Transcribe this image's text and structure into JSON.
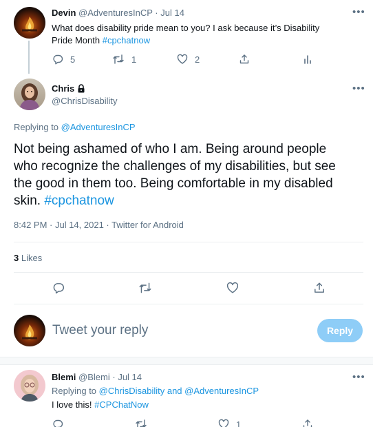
{
  "tweet1": {
    "name": "Devin",
    "handle": "@AdventuresInCP",
    "time": "Jul 14",
    "text_line1": "What does disability pride mean to you? I ask because it’s Disability",
    "text_line2": "Pride Month",
    "hashtag": "#cpchatnow",
    "replies": "5",
    "retweets": "1",
    "likes": "2"
  },
  "main_tweet": {
    "name": "Chris",
    "handle": "@ChrisDisability",
    "replying_prefix": "Replying to",
    "replying_handle": "@AdventuresInCP",
    "text_line1": "Not being ashamed of who I am. Being around people",
    "text_line2": "who recognize the challenges of my disabilities, but see",
    "text_line3": "the good in them too. Being comfortable in my disabled",
    "text_line4": "skin.",
    "hashtag": "#cpchatnow",
    "timestamp": "8:42 PM · Jul 14, 2021 · Twitter for Android",
    "likes_count": "3",
    "likes_label": "Likes"
  },
  "compose": {
    "placeholder": "Tweet your reply",
    "reply_button": "Reply"
  },
  "tweet3": {
    "name": "Blemi",
    "handle": "@Blemi",
    "time": "Jul 14",
    "replying_prefix": "Replying to",
    "replying_handle1": "@ChrisDisability",
    "replying_and": "and",
    "replying_handle2": "@AdventuresInCP",
    "text": "I love this!",
    "hashtag": "#CPChatNow",
    "likes": "1"
  },
  "colors": {
    "accent": "#1b95e0",
    "secondary_text": "#5b7083",
    "reply_button_disabled": "#8ecdf7"
  }
}
